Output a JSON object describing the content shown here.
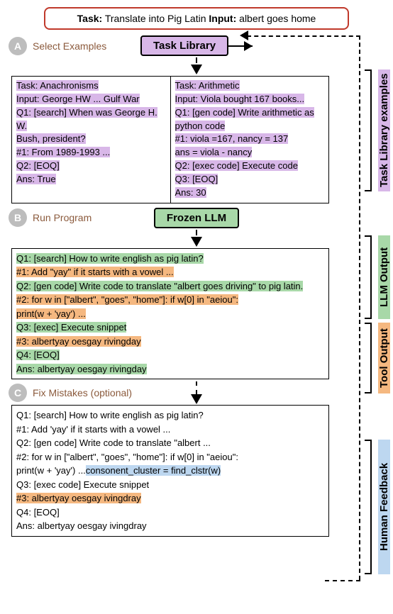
{
  "task_line": {
    "task_label": "Task:",
    "task_text": " Translate into Pig Latin ",
    "input_label": "Input:",
    "input_text": " albert goes home"
  },
  "steps": {
    "a": {
      "letter": "A",
      "label": "Select Examples"
    },
    "b": {
      "letter": "B",
      "label": "Run Program"
    },
    "c": {
      "letter": "C",
      "label": "Fix Mistakes (optional)"
    }
  },
  "boxes": {
    "task_library": "Task Library",
    "frozen_llm": "Frozen LLM"
  },
  "library": {
    "left": {
      "l1": "Task: Anachronisms",
      "l2": "Input: George HW ... Gulf War",
      "l3": "Q1: [search] When was George H. W.",
      "l4": "Bush, president?",
      "l5": "#1: From 1989-1993 ...",
      "l6": "Q2: [EOQ]",
      "l7": "Ans: True"
    },
    "right": {
      "l1": "Task: Arithmetic",
      "l2": "Input: Viola bought 167 books...",
      "l3": "Q1: [gen code] Write arithmetic as python code",
      "l4": "#1: viola =167, nancy = 137",
      "l5": "ans = viola - nancy",
      "l6": "Q2: [exec code] Execute code",
      "l7": "Q3: [EOQ]",
      "l8": "Ans: 30"
    }
  },
  "runbox": {
    "q1": "Q1: [search] How to write english as pig latin?",
    "a1": "#1: Add \"yay\" if it starts with a vowel ...",
    "q2": "Q2: [gen code] Write code to translate \"albert goes driving\" to pig latin.",
    "a2a": "#2:  for w in [\"albert\", \"goes\", \"home\"]: if w[0] in \"aeiou\":",
    "a2b": "print(w + 'yay') ...",
    "q3": "Q3: [exec] Execute snippet",
    "a3": "#3: albertyay oesgay rivingday",
    "q4": "Q4: [EOQ]",
    "ans": "Ans: albertyay oesgay rivingday"
  },
  "fixbox": {
    "q1": "Q1: [search] How to write english as pig latin?",
    "a1": "#1: Add 'yay' if it starts with a vowel ...",
    "q2": "Q2: [gen code] Write code to translate \"albert ...",
    "a2a": "#2:  for w in [\"albert\", \"goes\", \"home\"]: if w[0] in \"aeiou\":",
    "a2b_pre": "print(w + 'yay') ...",
    "a2b_edit": "consonent_cluster = find_clstr(w)",
    "q3": "Q3: [exec code] Execute snippet",
    "a3": "#3: albertyay oesgay ivingdray",
    "q4": "Q4: [EOQ]",
    "ans": "Ans: albertyay oesgay ivingdray"
  },
  "side_labels": {
    "task_lib": "Task Library examples",
    "llm_out": "LLM Output",
    "tool_out": "Tool Output",
    "feedback": "Human Feedback"
  }
}
